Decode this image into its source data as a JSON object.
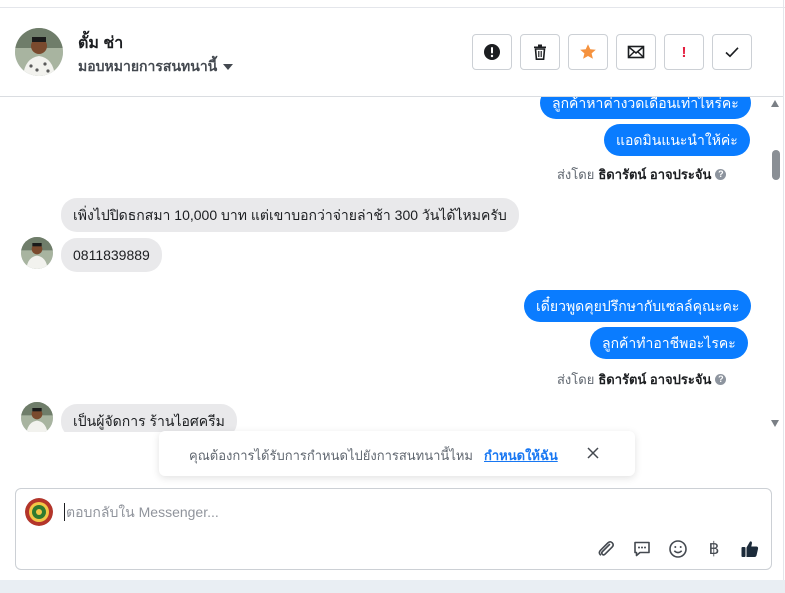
{
  "header": {
    "contact_name": "ตั้ม ช่า",
    "assign_label": "มอบหมายการสนทนานี้",
    "actions": [
      {
        "name": "spam-button",
        "icon": "alert-circle-icon"
      },
      {
        "name": "delete-button",
        "icon": "trash-icon"
      },
      {
        "name": "star-button",
        "icon": "star-icon",
        "color": "#f5923e"
      },
      {
        "name": "mark-unread-button",
        "icon": "envelope-icon"
      },
      {
        "name": "follow-up-button",
        "icon": "exclamation-icon",
        "label": "!",
        "color": "#e41e3f"
      },
      {
        "name": "done-button",
        "icon": "checkmark-icon"
      }
    ]
  },
  "conversation": {
    "messages": [
      {
        "direction": "out",
        "text": "ลูกค้าหาค่างวดเดือนเท่าไหร่คะ"
      },
      {
        "direction": "out",
        "text": "แอดมินแนะนำให้ค่ะ"
      },
      {
        "direction": "meta",
        "prefix": "ส่งโดย",
        "agent": "ธิดารัตน์ อาจประจัน"
      },
      {
        "direction": "in",
        "text": "เพิ่งไปปิดธกสมา 10,000 บาท แต่เขาบอกว่าจ่ายล่าช้า 300 วันได้ไหมครับ"
      },
      {
        "direction": "in",
        "text": "0811839889"
      },
      {
        "direction": "out",
        "text": "เดี๋ยวพูดคุยปรึกษากับเซลล์คุณะคะ"
      },
      {
        "direction": "out",
        "text": "ลูกค้าทำอาชีพอะไรคะ"
      },
      {
        "direction": "meta",
        "prefix": "ส่งโดย",
        "agent": "ธิดารัตน์ อาจประจัน"
      },
      {
        "direction": "in",
        "text": "เป็นผู้จัดการ ร้านไอศครีม"
      }
    ],
    "info_icon": "?"
  },
  "toast": {
    "text": "คุณต้องการได้รับการกำหนดไปยังการสนทนานี้ไหม",
    "link": "กำหนดให้ฉัน"
  },
  "composer": {
    "placeholder": "ตอบกลับใน Messenger...",
    "tools": [
      "paperclip-icon",
      "saved-reply-icon",
      "emoji-icon",
      "baht-icon",
      "thumbs-up-icon"
    ],
    "baht_symbol": "฿",
    "thumb_color": "#1c2b3a"
  },
  "colors": {
    "outgoing_bubble": "#0a7cff",
    "incoming_bubble": "#e9e9eb",
    "link": "#1877f2"
  }
}
